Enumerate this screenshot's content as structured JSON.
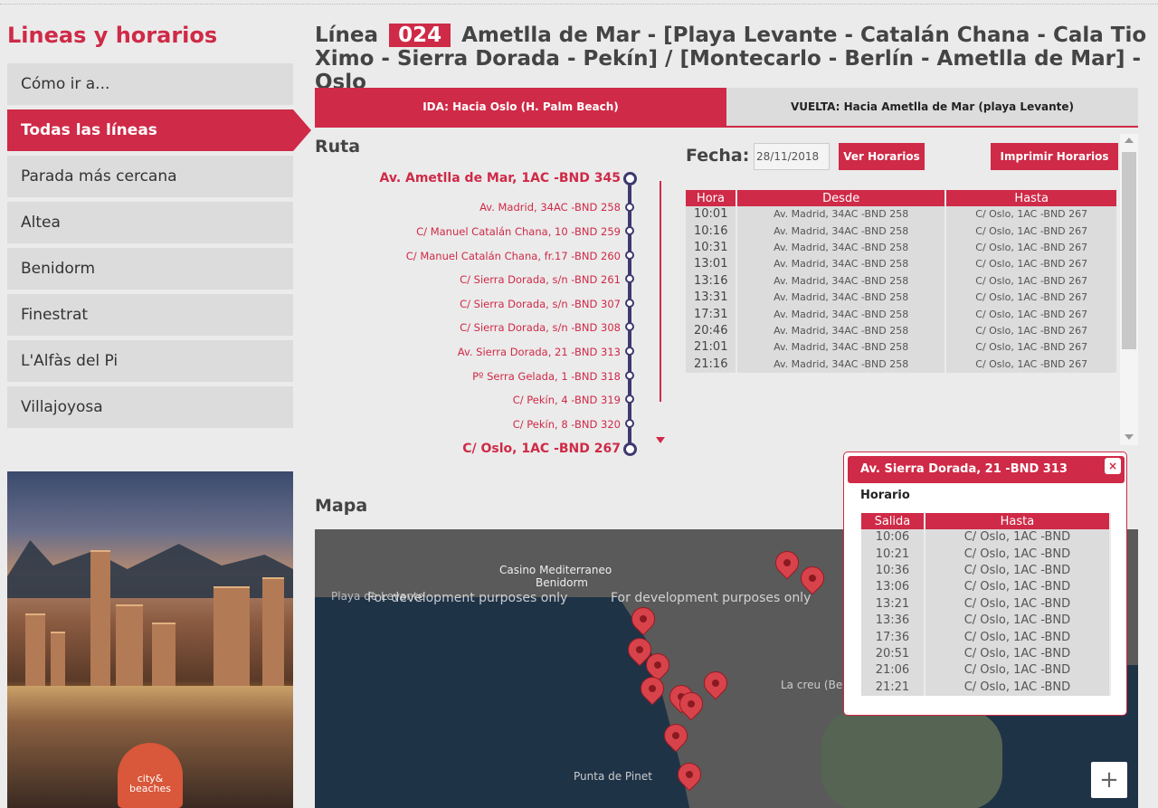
{
  "sidebar": {
    "title": "Lineas y horarios",
    "items": [
      {
        "label": "Cómo ir a..."
      },
      {
        "label": "Todas las líneas"
      },
      {
        "label": "Parada más cercana"
      },
      {
        "label": "Altea"
      },
      {
        "label": "Benidorm"
      },
      {
        "label": "Finestrat"
      },
      {
        "label": "L'Alfàs del Pi"
      },
      {
        "label": "Villajoyosa"
      }
    ],
    "promo_logo": "city& beaches"
  },
  "header": {
    "prefix": "Línea",
    "line_number": "024",
    "route_name": "Ametlla de Mar - [Playa Levante - Catalán Chana - Cala Tio Ximo - Sierra Dorada - Pekín] / [Montecarlo - Berlín - Ametlla de Mar] - Oslo"
  },
  "tabs": {
    "ida": "IDA: Hacia Oslo (H. Palm Beach)",
    "vuelta": "VUELTA: Hacia Ametlla de Mar (playa Levante)"
  },
  "route": {
    "title": "Ruta",
    "stops": [
      "Av. Ametlla de Mar, 1AC -BND 345",
      "Av. Madrid, 34AC -BND 258",
      "C/ Manuel Catalán Chana, 10 -BND 259",
      "C/ Manuel Catalán Chana, fr.17 -BND 260",
      "C/ Sierra Dorada, s/n -BND 261",
      "C/ Sierra Dorada, s/n -BND 307",
      "C/ Sierra Dorada, s/n -BND 308",
      "Av. Sierra Dorada, 21 -BND 313",
      "Pº Serra Gelada, 1 -BND 318",
      "C/ Pekín, 4 -BND 319",
      "C/ Pekín, 8 -BND 320",
      "C/ Oslo, 1AC -BND 267"
    ]
  },
  "schedule": {
    "fecha_label": "Fecha:",
    "fecha_value": "28/11/2018",
    "ver_label": "Ver Horarios",
    "imprimir_label": "Imprimir Horarios",
    "headers": [
      "Hora",
      "Desde",
      "Hasta"
    ],
    "rows": [
      [
        "10:01",
        "Av. Madrid, 34AC -BND 258",
        "C/ Oslo, 1AC -BND 267"
      ],
      [
        "10:16",
        "Av. Madrid, 34AC -BND 258",
        "C/ Oslo, 1AC -BND 267"
      ],
      [
        "10:31",
        "Av. Madrid, 34AC -BND 258",
        "C/ Oslo, 1AC -BND 267"
      ],
      [
        "13:01",
        "Av. Madrid, 34AC -BND 258",
        "C/ Oslo, 1AC -BND 267"
      ],
      [
        "13:16",
        "Av. Madrid, 34AC -BND 258",
        "C/ Oslo, 1AC -BND 267"
      ],
      [
        "13:31",
        "Av. Madrid, 34AC -BND 258",
        "C/ Oslo, 1AC -BND 267"
      ],
      [
        "17:31",
        "Av. Madrid, 34AC -BND 258",
        "C/ Oslo, 1AC -BND 267"
      ],
      [
        "20:46",
        "Av. Madrid, 34AC -BND 258",
        "C/ Oslo, 1AC -BND 267"
      ],
      [
        "21:01",
        "Av. Madrid, 34AC -BND 258",
        "C/ Oslo, 1AC -BND 267"
      ],
      [
        "21:16",
        "Av. Madrid, 34AC -BND 258",
        "C/ Oslo, 1AC -BND 267"
      ]
    ]
  },
  "map": {
    "title": "Mapa",
    "labels": {
      "casino": "Casino Mediterraneo",
      "benidorm": "Benidorm",
      "playa": "Playa de Levante",
      "dev1": "For development purposes only",
      "dev2": "For development purposes only",
      "creu": "La creu (Be",
      "punta": "Punta de Pinet"
    },
    "zoom_in": "+"
  },
  "popup": {
    "title": "Av. Sierra Dorada, 21 -BND 313",
    "close": "×",
    "subtitle": "Horario",
    "headers": [
      "Salida",
      "Hasta"
    ],
    "rows": [
      [
        "10:06",
        "C/ Oslo, 1AC -BND"
      ],
      [
        "10:21",
        "C/ Oslo, 1AC -BND"
      ],
      [
        "10:36",
        "C/ Oslo, 1AC -BND"
      ],
      [
        "13:06",
        "C/ Oslo, 1AC -BND"
      ],
      [
        "13:21",
        "C/ Oslo, 1AC -BND"
      ],
      [
        "13:36",
        "C/ Oslo, 1AC -BND"
      ],
      [
        "17:36",
        "C/ Oslo, 1AC -BND"
      ],
      [
        "20:51",
        "C/ Oslo, 1AC -BND"
      ],
      [
        "21:06",
        "C/ Oslo, 1AC -BND"
      ],
      [
        "21:21",
        "C/ Oslo, 1AC -BND"
      ]
    ]
  },
  "colors": {
    "accent": "#cf2a47",
    "route_line": "#3c3a6e"
  }
}
